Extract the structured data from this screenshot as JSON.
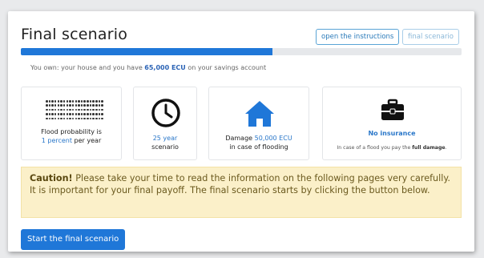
{
  "header": {
    "title": "Final scenario",
    "instructions_button": "open the instructions",
    "scenario_button": "final scenario"
  },
  "progress": {
    "fraction": 0.57
  },
  "savings": {
    "prefix": "You own: your house and you have ",
    "amount": "65,000 ECU",
    "suffix": " on your savings account"
  },
  "cards": {
    "flood": {
      "icon": "dot-grid-icon",
      "line1": "Flood probability is",
      "value": "1 percent",
      "suffix": " per year"
    },
    "duration": {
      "icon": "clock-icon",
      "value": "25 year",
      "label": "scenario"
    },
    "damage": {
      "icon": "house-icon",
      "prefix": "Damage ",
      "value": "50,000 ECU",
      "line2": "in case of flooding"
    },
    "insurance": {
      "icon": "briefcase-icon",
      "title": "No insurance",
      "note_prefix": "In case of a flood you pay the ",
      "note_bold": "full damage",
      "note_suffix": "."
    }
  },
  "caution": {
    "label": "Caution!",
    "text": " Please take your time to read the information on the following pages very carefully. It is important for your final payoff. The final scenario starts by clicking the button below."
  },
  "start_button": "Start the final scenario",
  "colors": {
    "primary": "#1f77d8",
    "caution_bg": "#fbf0c9",
    "accent_text": "#2a77c9"
  }
}
